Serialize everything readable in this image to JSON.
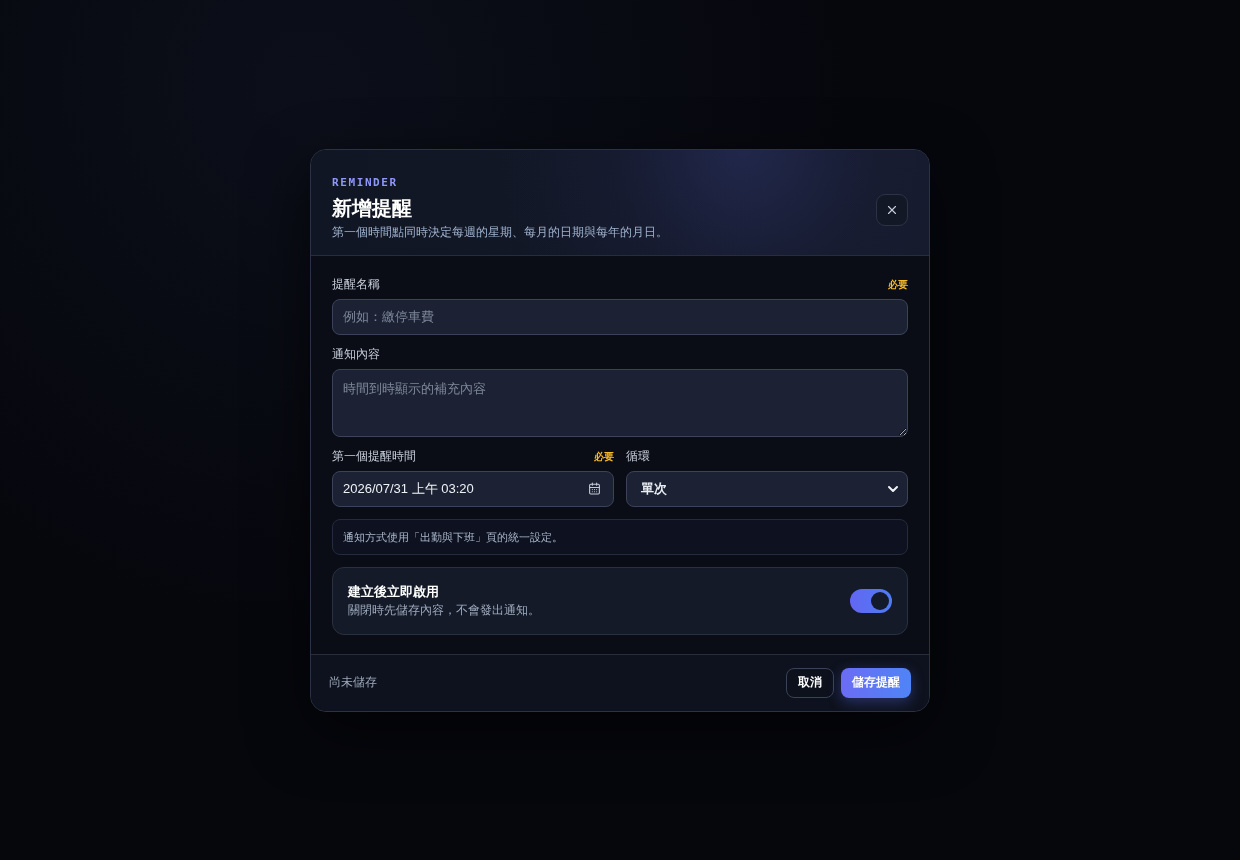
{
  "dialog": {
    "eyebrow": "REMINDER",
    "title": "新增提醒",
    "subtitle": "第一個時間點同時決定每週的星期、每月的日期與每年的月日。"
  },
  "fields": [
    {
      "kind": "text",
      "label": "提醒名稱",
      "badge": "必要",
      "placeholder": "例如：繳停車費"
    },
    {
      "kind": "textarea",
      "label": "通知內容",
      "placeholder": "時間到時顯示的補充內容"
    }
  ],
  "schedule": [
    {
      "kind": "datetime",
      "label": "第一個提醒時間",
      "badge": "必要",
      "value": "2026/07/31 上午 03:20"
    },
    {
      "kind": "select",
      "label": "循環",
      "value": "單次"
    }
  ],
  "note": "通知方式使用「出勤與下班」頁的統一設定。",
  "enable_toggle": {
    "title": "建立後立即啟用",
    "description": "關閉時先儲存內容，不會發出通知。",
    "on": true
  },
  "footer": {
    "status": "尚未儲存",
    "buttons": [
      {
        "label": "取消",
        "kind": "secondary"
      },
      {
        "label": "儲存提醒",
        "kind": "primary"
      }
    ]
  }
}
